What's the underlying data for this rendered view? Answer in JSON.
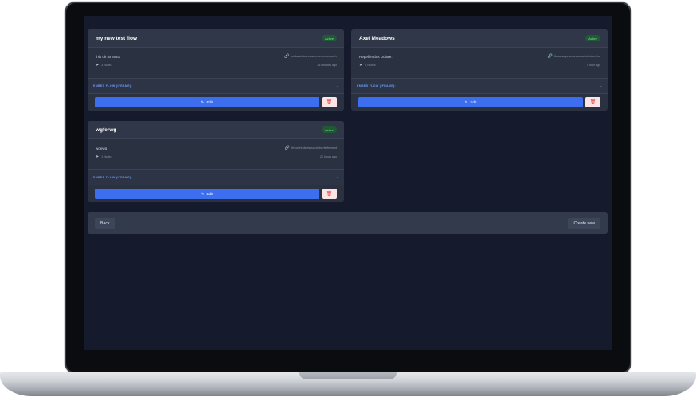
{
  "flows": [
    {
      "title": "my new test flow",
      "status": "Active",
      "description": "this ok for tests",
      "flow_id": "cuidazcbduchousezeoecurmccovcfv",
      "nodes": "3 Nodes",
      "updated": "13 minutes ago",
      "embed_label": "EMBED FLOW (IFRAME):",
      "edit_label": "Edit"
    },
    {
      "title": "Axel Meadows",
      "status": "Active",
      "description": "Repellendus Dolore.",
      "flow_id": "8uoapauyzwsrozdoctaebdeobcesfsd",
      "nodes": "8 Nodes",
      "updated": "1 hour ago",
      "embed_label": "EMBED FLOW (IFRAME):",
      "edit_label": "Edit"
    },
    {
      "title": "wgferwg",
      "status": "Active",
      "description": "wgewg",
      "flow_id": "frf4orbrfudsetscsxzxtcbzeferfefmrxd",
      "nodes": "1 Nodes",
      "updated": "22 hours ago",
      "embed_label": "EMBED FLOW (IFRAME):",
      "edit_label": "Edit"
    }
  ],
  "footer": {
    "back_label": "Back",
    "create_label": "Create new"
  },
  "icons": {
    "link": "link-icon",
    "nodes": "send-icon",
    "chevron": "chevron-down-icon",
    "edit": "edit-icon",
    "delete": "trash-icon"
  },
  "colors": {
    "accent": "#3d6ef0",
    "status_active_bg": "#1f5a34",
    "status_active_text": "#7be39a",
    "delete": "#e04545",
    "screen_bg": "#151b2c"
  }
}
